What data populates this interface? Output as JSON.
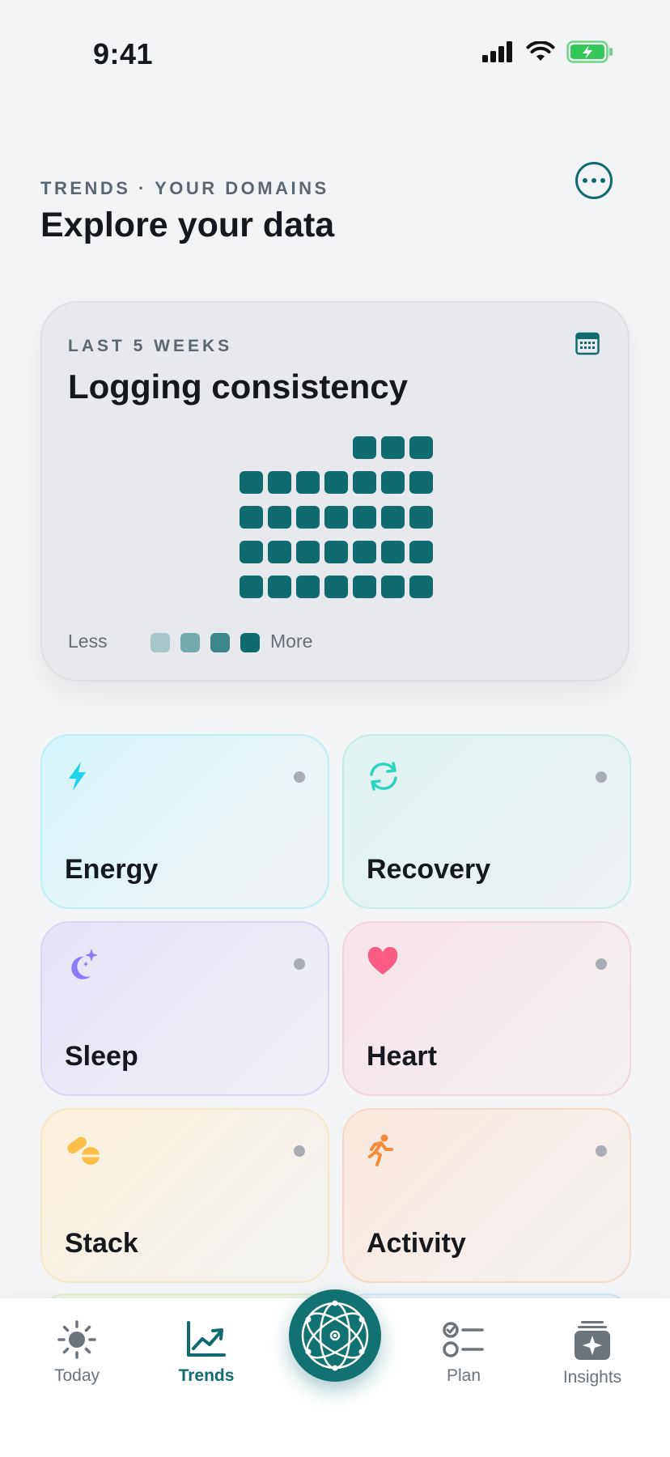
{
  "status_bar": {
    "time": "9:41",
    "battery_color": "#34c759"
  },
  "header": {
    "eyebrow": "TRENDS · YOUR DOMAINS",
    "title": "Explore your data",
    "more_icon": "more-horizontal-icon"
  },
  "consistency_card": {
    "eyebrow": "LAST 5 WEEKS",
    "title": "Logging consistency",
    "icon": "calendar-icon",
    "heatmap": {
      "accent": "#0f6b6f",
      "rows": [
        [
          null,
          null,
          null,
          null,
          4,
          4,
          4
        ],
        [
          4,
          4,
          4,
          4,
          4,
          4,
          4
        ],
        [
          4,
          4,
          4,
          4,
          4,
          4,
          4
        ],
        [
          4,
          4,
          4,
          4,
          4,
          4,
          4
        ],
        [
          4,
          4,
          4,
          4,
          4,
          4,
          4
        ]
      ]
    },
    "legend": {
      "less_label": "Less",
      "more_label": "More",
      "levels": [
        "#a7c7ca",
        "#74a9ad",
        "#3d878b",
        "#0f6b6f"
      ]
    }
  },
  "domains": [
    {
      "label": "Energy",
      "icon": "lightning-bolt-icon",
      "accent": "#22d3ee"
    },
    {
      "label": "Recovery",
      "icon": "refresh-arrows-icon",
      "accent": "#2dd4bf"
    },
    {
      "label": "Sleep",
      "icon": "moon-sparkle-icon",
      "accent": "#8b7cf6"
    },
    {
      "label": "Heart",
      "icon": "heart-icon",
      "accent": "#fb5c85"
    },
    {
      "label": "Stack",
      "icon": "pills-icon",
      "accent": "#fbbf4a"
    },
    {
      "label": "Activity",
      "icon": "running-person-icon",
      "accent": "#f58a3a"
    }
  ],
  "bottom_nav": {
    "items": [
      {
        "label": "Today",
        "icon": "sun-icon",
        "active": false
      },
      {
        "label": "Trends",
        "icon": "trend-chart-icon",
        "active": true
      },
      {
        "label": "Plan",
        "icon": "checklist-icon",
        "active": false
      },
      {
        "label": "Insights",
        "icon": "sparkle-stack-icon",
        "active": false
      }
    ],
    "center_icon": "orbit-logo-icon"
  }
}
